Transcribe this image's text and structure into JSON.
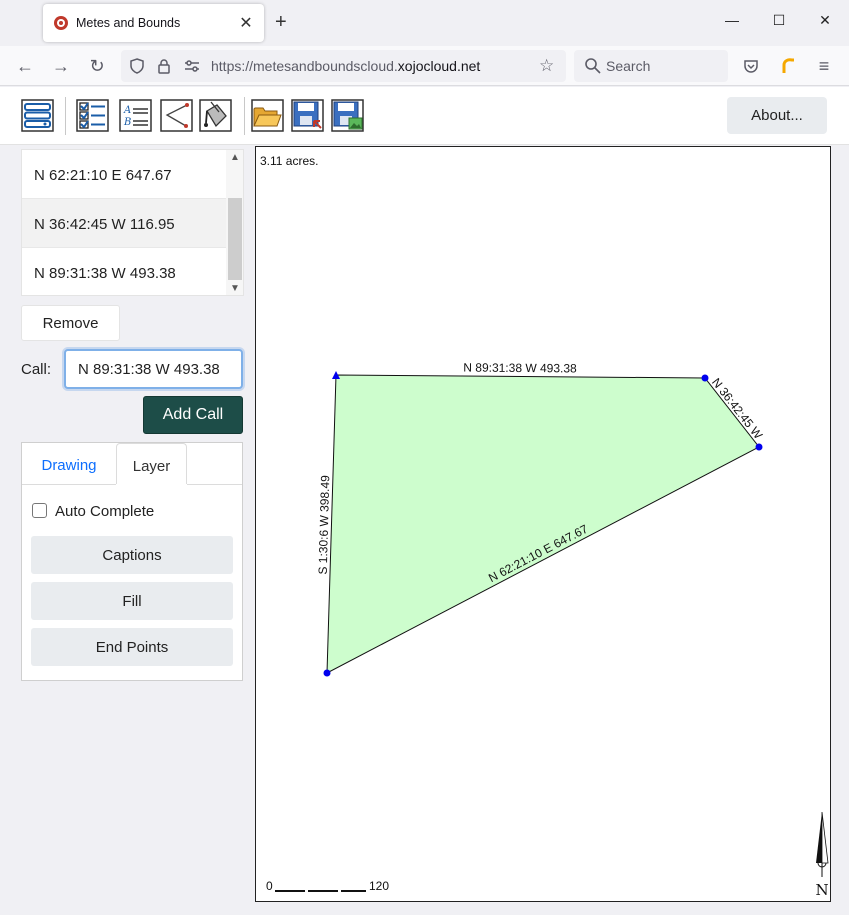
{
  "browser": {
    "tab_title": "Metes and Bounds",
    "new_tab": "+",
    "close_tab": "✕",
    "window_controls": {
      "minimize": "—",
      "maximize": "☐",
      "close": "✕"
    },
    "url_prefix": "https://metesandboundscloud.",
    "url_host": "xojocloud.net",
    "search_placeholder": "Search"
  },
  "toolbar": {
    "about_label": "About...",
    "icons": [
      "layers-icon",
      "checklist-icon",
      "ab-list-icon",
      "line-segment-icon",
      "paint-bucket-icon",
      "open-folder-icon",
      "save-export-icon",
      "save-image-icon"
    ]
  },
  "calls": {
    "items": [
      {
        "label": "N 62:21:10 E 647.67"
      },
      {
        "label": "N 36:42:45 W 116.95"
      },
      {
        "label": "N 89:31:38 W 493.38"
      }
    ],
    "selected_index": 1
  },
  "actions": {
    "remove_label": "Remove",
    "call_label": "Call:",
    "call_value": "N 89:31:38 W 493.38",
    "add_call_label": "Add Call"
  },
  "panel": {
    "tabs": [
      {
        "label": "Drawing"
      },
      {
        "label": "Layer"
      }
    ],
    "active_tab": "Layer",
    "auto_complete_label": "Auto Complete",
    "auto_complete_checked": false,
    "buttons": [
      {
        "label": "Captions"
      },
      {
        "label": "Fill"
      },
      {
        "label": "End Points"
      }
    ]
  },
  "drawing": {
    "area": "3.11 acres.",
    "fill_color": "#cdfdcd",
    "point_color": "#0000ee",
    "edge_labels": [
      "N 89:31:38 W 493.38",
      "N 36:42:45 W",
      "N 62:21:10 E 647.67",
      "S 1:30:6 W 398.49"
    ],
    "scale": {
      "start": "0",
      "end": "120"
    },
    "north_label": "N"
  }
}
